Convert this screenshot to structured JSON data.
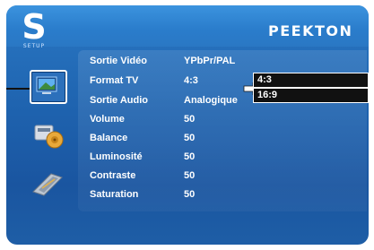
{
  "header": {
    "logo_letter": "S",
    "logo_caption": "SETUP",
    "brand": "PEEKTON"
  },
  "menu": {
    "items": [
      {
        "label": "Sortie Vidéo",
        "value": "YPbPr/PAL"
      },
      {
        "label": "Format TV",
        "value": "4:3"
      },
      {
        "label": "Sortie Audio",
        "value": "Analogique"
      },
      {
        "label": "Volume",
        "value": "50"
      },
      {
        "label": "Balance",
        "value": "50"
      },
      {
        "label": "Luminosité",
        "value": "50"
      },
      {
        "label": "Contraste",
        "value": "50"
      },
      {
        "label": "Saturation",
        "value": "50"
      }
    ]
  },
  "dropdown": {
    "options": [
      {
        "label": "4:3"
      },
      {
        "label": "16:9"
      }
    ]
  },
  "sidebar": {
    "icons": [
      "video-icon",
      "audio-icon",
      "misc-icon"
    ]
  },
  "colors": {
    "background": "#1e62ae",
    "dropdown_bg": "#111111",
    "text": "#ffffff"
  }
}
